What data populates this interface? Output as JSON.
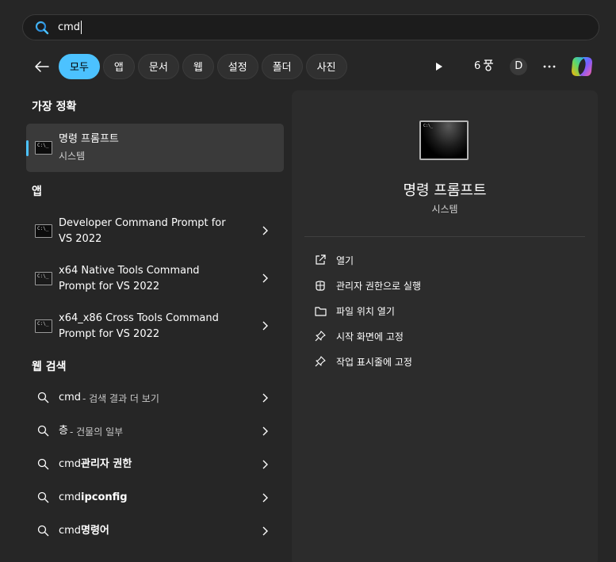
{
  "search": {
    "value": "cmd"
  },
  "filters": {
    "chips": [
      "모두",
      "앱",
      "문서",
      "웹",
      "설정",
      "폴더",
      "사진"
    ],
    "active_index": 0
  },
  "header_controls": {
    "badge_count": "6",
    "avatar_letter": "D"
  },
  "best_match": {
    "heading": "가장 정확",
    "title": "명령 프롬프트",
    "subtitle": "시스템"
  },
  "apps": {
    "heading": "앱",
    "items": [
      {
        "line1": "Developer Command Prompt for",
        "line2": "VS 2022"
      },
      {
        "line1": "x64 Native Tools Command",
        "line2": "Prompt for VS 2022"
      },
      {
        "line1": "x64_x86 Cross Tools Command",
        "line2": "Prompt for VS 2022"
      }
    ]
  },
  "web": {
    "heading": "웹 검색",
    "items": [
      {
        "query": "cmd",
        "suffix": " - 검색 결과 더 보기",
        "bold": false
      },
      {
        "query": "층",
        "suffix": " - 건물의 일부",
        "bold": false
      },
      {
        "query": "cmd",
        "suffix": " 관리자 권한",
        "bold": true
      },
      {
        "query": "cmd",
        "suffix": " ipconfig",
        "bold": true
      },
      {
        "query": "cmd",
        "suffix": " 명령어",
        "bold": true
      }
    ]
  },
  "preview": {
    "title": "명령 프롬프트",
    "subtitle": "시스템",
    "actions": [
      {
        "label": "열기",
        "icon": "open-external-icon"
      },
      {
        "label": "관리자 권한으로 실행",
        "icon": "shield-icon"
      },
      {
        "label": "파일 위치 열기",
        "icon": "folder-icon"
      },
      {
        "label": "시작 화면에 고정",
        "icon": "pin-icon"
      },
      {
        "label": "작업 표시줄에 고정",
        "icon": "pin-icon"
      }
    ]
  },
  "colors": {
    "accent": "#4cc2ff",
    "background": "#262626",
    "pane": "#2c2c2c"
  }
}
